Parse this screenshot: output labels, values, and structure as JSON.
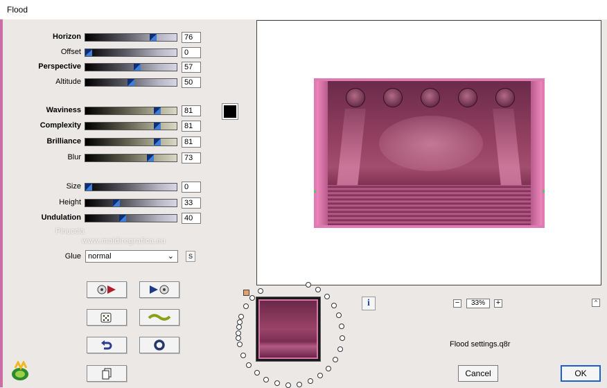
{
  "window": {
    "title": "Flood"
  },
  "sliders": [
    {
      "label": "Horizon",
      "value": "76",
      "fraction": 0.76,
      "bold": true,
      "track": "gray"
    },
    {
      "label": "Offset",
      "value": "0",
      "fraction": 0.0,
      "bold": false,
      "track": "gray"
    },
    {
      "label": "Perspective",
      "value": "57",
      "fraction": 0.57,
      "bold": true,
      "track": "gray"
    },
    {
      "label": "Altitude",
      "value": "50",
      "fraction": 0.5,
      "bold": false,
      "track": "gray"
    },
    {
      "label": "Waviness",
      "value": "81",
      "fraction": 0.81,
      "bold": true,
      "track": "olive"
    },
    {
      "label": "Complexity",
      "value": "81",
      "fraction": 0.81,
      "bold": true,
      "track": "olive"
    },
    {
      "label": "Brilliance",
      "value": "81",
      "fraction": 0.81,
      "bold": true,
      "track": "olive"
    },
    {
      "label": "Blur",
      "value": "73",
      "fraction": 0.73,
      "bold": false,
      "track": "olive"
    },
    {
      "label": "Size",
      "value": "0",
      "fraction": 0.0,
      "bold": false,
      "track": "gray"
    },
    {
      "label": "Height",
      "value": "33",
      "fraction": 0.33,
      "bold": false,
      "track": "gray"
    },
    {
      "label": "Undulation",
      "value": "40",
      "fraction": 0.4,
      "bold": true,
      "track": "gray"
    }
  ],
  "color_swatch": {
    "color": "#000000"
  },
  "glue": {
    "label": "Glue",
    "value": "normal",
    "s_button": "S"
  },
  "tool_buttons": [
    {
      "name": "load-preset-button",
      "icon": "disc-arrow-icon"
    },
    {
      "name": "save-preset-button",
      "icon": "arrow-disc-icon"
    },
    {
      "name": "randomize-button",
      "icon": "dice-icon"
    },
    {
      "name": "wave-button",
      "icon": "wave-icon"
    },
    {
      "name": "undo-button",
      "icon": "undo-icon"
    },
    {
      "name": "reset-button",
      "icon": "ring-icon"
    },
    {
      "name": "copy-button",
      "icon": "copy-icon"
    }
  ],
  "zoom": {
    "minus": "−",
    "value": "33%",
    "plus": "+"
  },
  "info_icon": "i",
  "collapse_button": "^",
  "settings_file": "Flood settings.q8r",
  "buttons": {
    "cancel": "Cancel",
    "ok": "OK"
  },
  "watermark": {
    "line1": "Pinuccia",
    "line2": "www.maldiregrafica.eu"
  }
}
